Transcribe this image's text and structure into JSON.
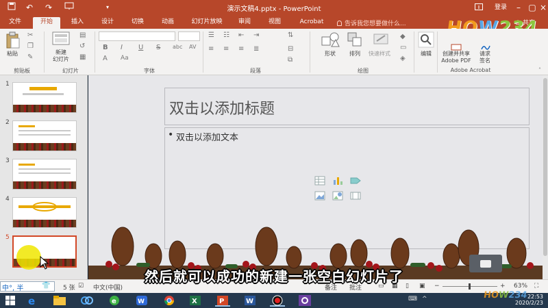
{
  "window": {
    "title": "演示文稿4.pptx - PowerPoint",
    "login_label": "登录",
    "quick_access": [
      "save-icon",
      "undo-icon",
      "redo-icon",
      "slideshow-icon",
      "customize-icon"
    ]
  },
  "tabs": [
    "文件",
    "开始",
    "插入",
    "设计",
    "切换",
    "动画",
    "幻灯片放映",
    "审阅",
    "视图",
    "Acrobat"
  ],
  "active_tab": "开始",
  "tell_me": "告诉我您想要做什么...",
  "share_label": "共享",
  "logo": {
    "text": "HOW234"
  },
  "ribbon": {
    "clipboard": {
      "paste": "粘贴",
      "group": "剪贴板"
    },
    "slides": {
      "new_slide": "新建\n幻灯片",
      "group": "幻灯片"
    },
    "font": {
      "group": "字体",
      "buttons": [
        "B",
        "I",
        "U",
        "S",
        "abc",
        "AV",
        "Aa",
        "A"
      ]
    },
    "paragraph": {
      "group": "段落"
    },
    "drawing": {
      "shapes": "形状",
      "arrange": "排列",
      "quick_styles": "快速样式",
      "group": "绘图"
    },
    "editing": {
      "label": "编辑"
    },
    "acrobat": {
      "create_share": "创建并共享\nAdobe PDF",
      "request_sign": "请求\n签名",
      "group": "Adobe Acrobat"
    }
  },
  "thumbnails": [
    {
      "num": "1"
    },
    {
      "num": "2"
    },
    {
      "num": "3"
    },
    {
      "num": "4"
    },
    {
      "num": "5"
    }
  ],
  "slide": {
    "title_placeholder": "双击以添加标题",
    "bullet": "•",
    "body_placeholder": "双击以添加文本"
  },
  "statusbar": {
    "slide_count": "5 张",
    "language": "中文(中国)",
    "notes": "备注",
    "comments": "批注",
    "zoom": "63%"
  },
  "ime": {
    "label": "中°, 半"
  },
  "caption": "然后就可以成功的新建一张空白幻灯片了",
  "taskbar": {
    "apps": [
      "start-icon",
      "ie-icon",
      "file-explorer-icon",
      "baidu-netdisk-icon",
      "browser-360-icon",
      "wps-icon",
      "chrome-icon",
      "excel-icon",
      "powerpoint-icon",
      "word-icon",
      "recorder-icon",
      "settings-icon"
    ],
    "time": "22:53",
    "date": "2020/2/23"
  },
  "colors": {
    "accent": "#b7472a",
    "active_thumb": "#d24726"
  }
}
